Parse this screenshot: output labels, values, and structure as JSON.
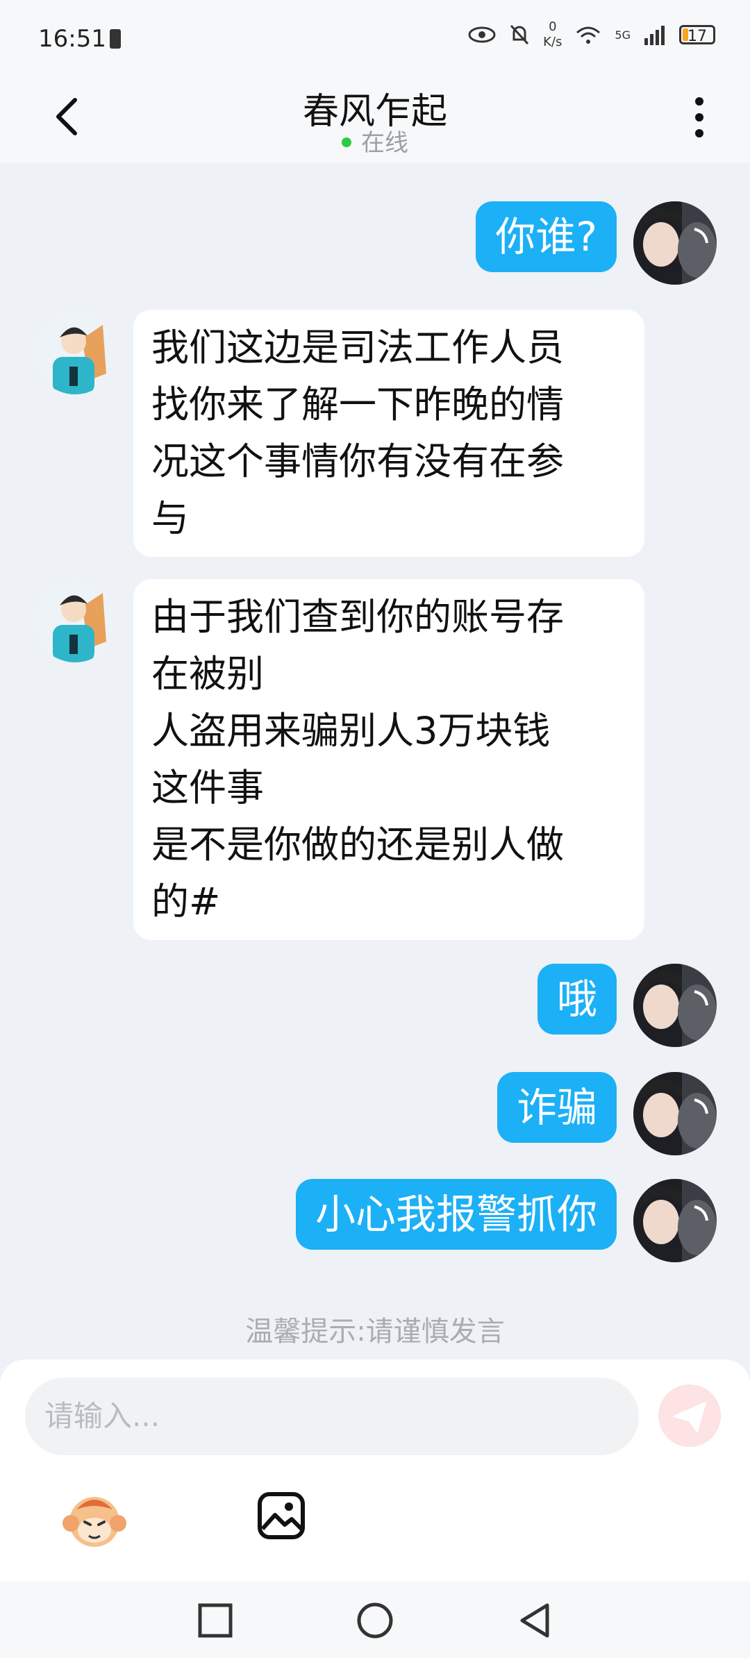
{
  "status_bar": {
    "time": "16:51",
    "speed_value": "0",
    "speed_unit": "K/s",
    "network": "5G",
    "battery": "17"
  },
  "header": {
    "title": "春风乍起",
    "status": "在线"
  },
  "messages": [
    {
      "side": "out",
      "text": "你谁?"
    },
    {
      "side": "in",
      "text": "我们这边是司法工作人员\n找你来了解一下昨晚的情\n况这个事情你有没有在参\n与"
    },
    {
      "side": "in",
      "text": "由于我们查到你的账号存\n在被别\n人盗用来骗别人3万块钱\n这件事\n是不是你做的还是别人做\n的#"
    },
    {
      "side": "out",
      "text": "哦"
    },
    {
      "side": "out",
      "text": "诈骗"
    },
    {
      "side": "out",
      "text": "小心我报警抓你"
    }
  ],
  "tip": "温馨提示:请谨慎发言",
  "input": {
    "placeholder": "请输入..."
  },
  "colors": {
    "accent": "#1cb0f6",
    "background": "#eef1f6",
    "online_dot": "#2ecc40"
  },
  "icons": {
    "back": "chevron-left-icon",
    "more": "more-vertical-icon",
    "send": "send-icon",
    "emoji": "monkey-sticker-icon",
    "image": "image-icon"
  }
}
